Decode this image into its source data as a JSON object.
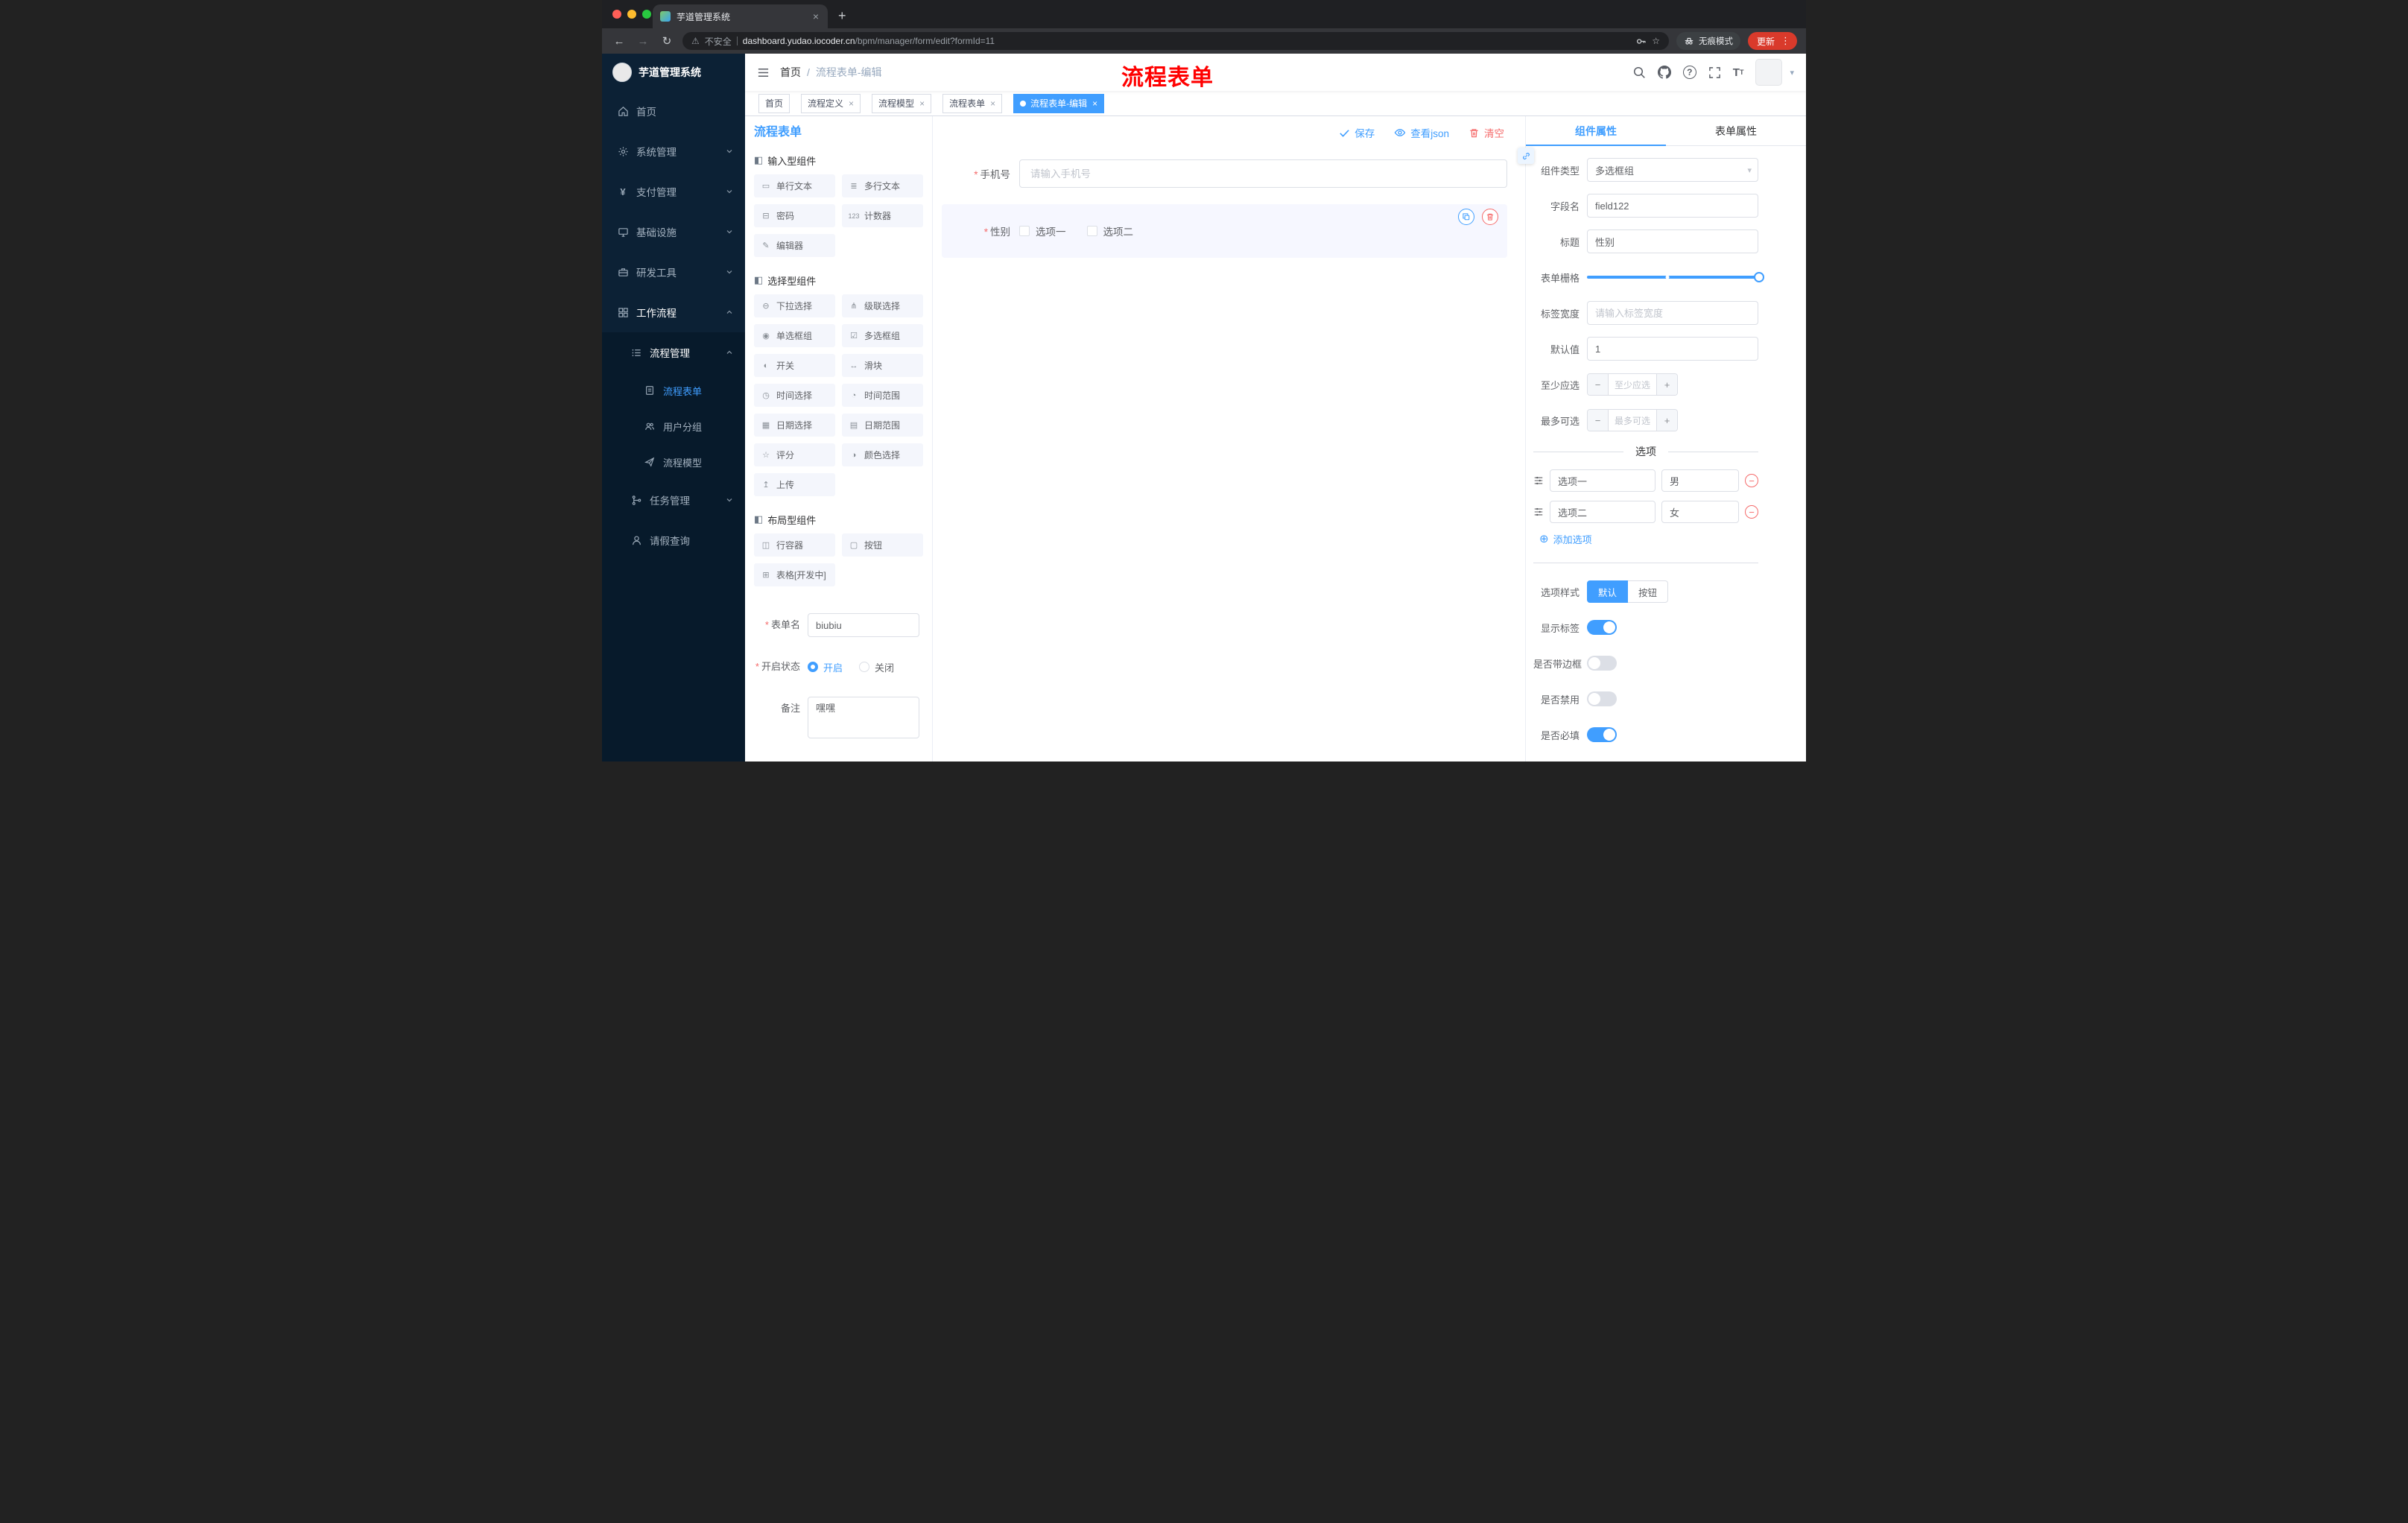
{
  "colors": {
    "accent": "#409eff",
    "danger": "#f56c6c",
    "sidebar_bg": "#0c2135",
    "submenu_bg": "#071a2b",
    "chrome_update": "#d93a2b",
    "annotation": "#ff0000",
    "tag_active": "#409eff"
  },
  "icons": {
    "close": "×",
    "new_tab": "+",
    "back": "←",
    "forward": "→",
    "reload": "↻",
    "warning": "⚠",
    "star": "☆",
    "kebab": "⋮",
    "caret_down": "▾",
    "minus": "−",
    "plus": "+",
    "add_circle": "⊕",
    "remove": "−",
    "section": "◧"
  },
  "browser": {
    "tab_title": "芋道管理系统",
    "security_label": "不安全",
    "url_host": "dashboard.yudao.iocoder.cn",
    "url_path": "/bpm/manager/form/edit?formId=11",
    "incognito_label": "无痕模式",
    "update_label": "更新"
  },
  "annotation": {
    "text": "流程表单"
  },
  "sidebar": {
    "logo_title": "芋道管理系统",
    "items": [
      {
        "label": "首页"
      },
      {
        "label": "系统管理"
      },
      {
        "label": "支付管理"
      },
      {
        "label": "基础设施"
      },
      {
        "label": "研发工具"
      },
      {
        "label": "工作流程"
      },
      {
        "label": "流程管理"
      },
      {
        "label": "流程表单"
      },
      {
        "label": "用户分组"
      },
      {
        "label": "流程模型"
      },
      {
        "label": "任务管理"
      },
      {
        "label": "请假查询"
      }
    ]
  },
  "header": {
    "breadcrumb_home": "首页",
    "breadcrumb_separator": "/",
    "breadcrumb_current": "流程表单-编辑"
  },
  "tags": [
    {
      "label": "首页",
      "active": false,
      "closable": false
    },
    {
      "label": "流程定义",
      "active": false,
      "closable": true
    },
    {
      "label": "流程模型",
      "active": false,
      "closable": true
    },
    {
      "label": "流程表单",
      "active": false,
      "closable": true
    },
    {
      "label": "流程表单-编辑",
      "active": true,
      "closable": true
    }
  ],
  "designer": {
    "title": "流程表单",
    "actions": {
      "save": "保存",
      "view_json": "查看json",
      "clear": "清空"
    },
    "palette": {
      "sections": [
        {
          "title": "输入型组件",
          "items": [
            {
              "icon": "▭",
              "label": "单行文本"
            },
            {
              "icon": "≣",
              "label": "多行文本"
            },
            {
              "icon": "⊟",
              "label": "密码"
            },
            {
              "icon": "123",
              "label": "计数器"
            },
            {
              "icon": "✎",
              "label": "编辑器"
            }
          ]
        },
        {
          "title": "选择型组件",
          "items": [
            {
              "icon": "⊖",
              "label": "下拉选择"
            },
            {
              "icon": "⋔",
              "label": "级联选择"
            },
            {
              "icon": "◉",
              "label": "单选框组"
            },
            {
              "icon": "☑",
              "label": "多选框组"
            },
            {
              "icon": "◐",
              "label": "开关"
            },
            {
              "icon": "↔",
              "label": "滑块"
            },
            {
              "icon": "◷",
              "label": "时间选择"
            },
            {
              "icon": "◔",
              "label": "时间范围"
            },
            {
              "icon": "▦",
              "label": "日期选择"
            },
            {
              "icon": "▤",
              "label": "日期范围"
            },
            {
              "icon": "☆",
              "label": "评分"
            },
            {
              "icon": "◑",
              "label": "颜色选择"
            },
            {
              "icon": "↥",
              "label": "上传"
            }
          ]
        },
        {
          "title": "布局型组件",
          "items": [
            {
              "icon": "◫",
              "label": "行容器"
            },
            {
              "icon": "▢",
              "label": "按钮"
            },
            {
              "icon": "⊞",
              "label": "表格[开发中]"
            }
          ]
        }
      ]
    },
    "form": {
      "name_label": "表单名",
      "name_value": "biubiu",
      "status_label": "开启状态",
      "status_on": "开启",
      "status_off": "关闭",
      "status_value": "开启",
      "remark_label": "备注",
      "remark_value": "嘿嘿"
    },
    "canvas": {
      "phone_label": "手机号",
      "phone_placeholder": "请输入手机号",
      "gender_label": "性别",
      "gender_options": [
        "选项一",
        "选项二"
      ]
    },
    "props": {
      "tab_component": "组件属性",
      "tab_form": "表单属性",
      "active_tab": "组件属性",
      "component_type_label": "组件类型",
      "component_type_value": "多选框组",
      "field_name_label": "字段名",
      "field_name_value": "field122",
      "title_label": "标题",
      "title_value": "性别",
      "grid_label": "表单栅格",
      "label_width_label": "标签宽度",
      "label_width_placeholder": "请输入标签宽度",
      "default_label": "默认值",
      "default_value": "1",
      "min_label": "至少应选",
      "min_placeholder": "至少应选",
      "max_label": "最多可选",
      "max_placeholder": "最多可选",
      "options_title": "选项",
      "options": [
        {
          "label": "选项一",
          "value": "男"
        },
        {
          "label": "选项二",
          "value": "女"
        }
      ],
      "add_option_label": "添加选项",
      "style_label": "选项样式",
      "style_options": [
        "默认",
        "按钮"
      ],
      "style_value": "默认",
      "switches": [
        {
          "label": "显示标签",
          "on": true
        },
        {
          "label": "是否带边框",
          "on": false
        },
        {
          "label": "是否禁用",
          "on": false
        },
        {
          "label": "是否必填",
          "on": true
        }
      ]
    }
  }
}
